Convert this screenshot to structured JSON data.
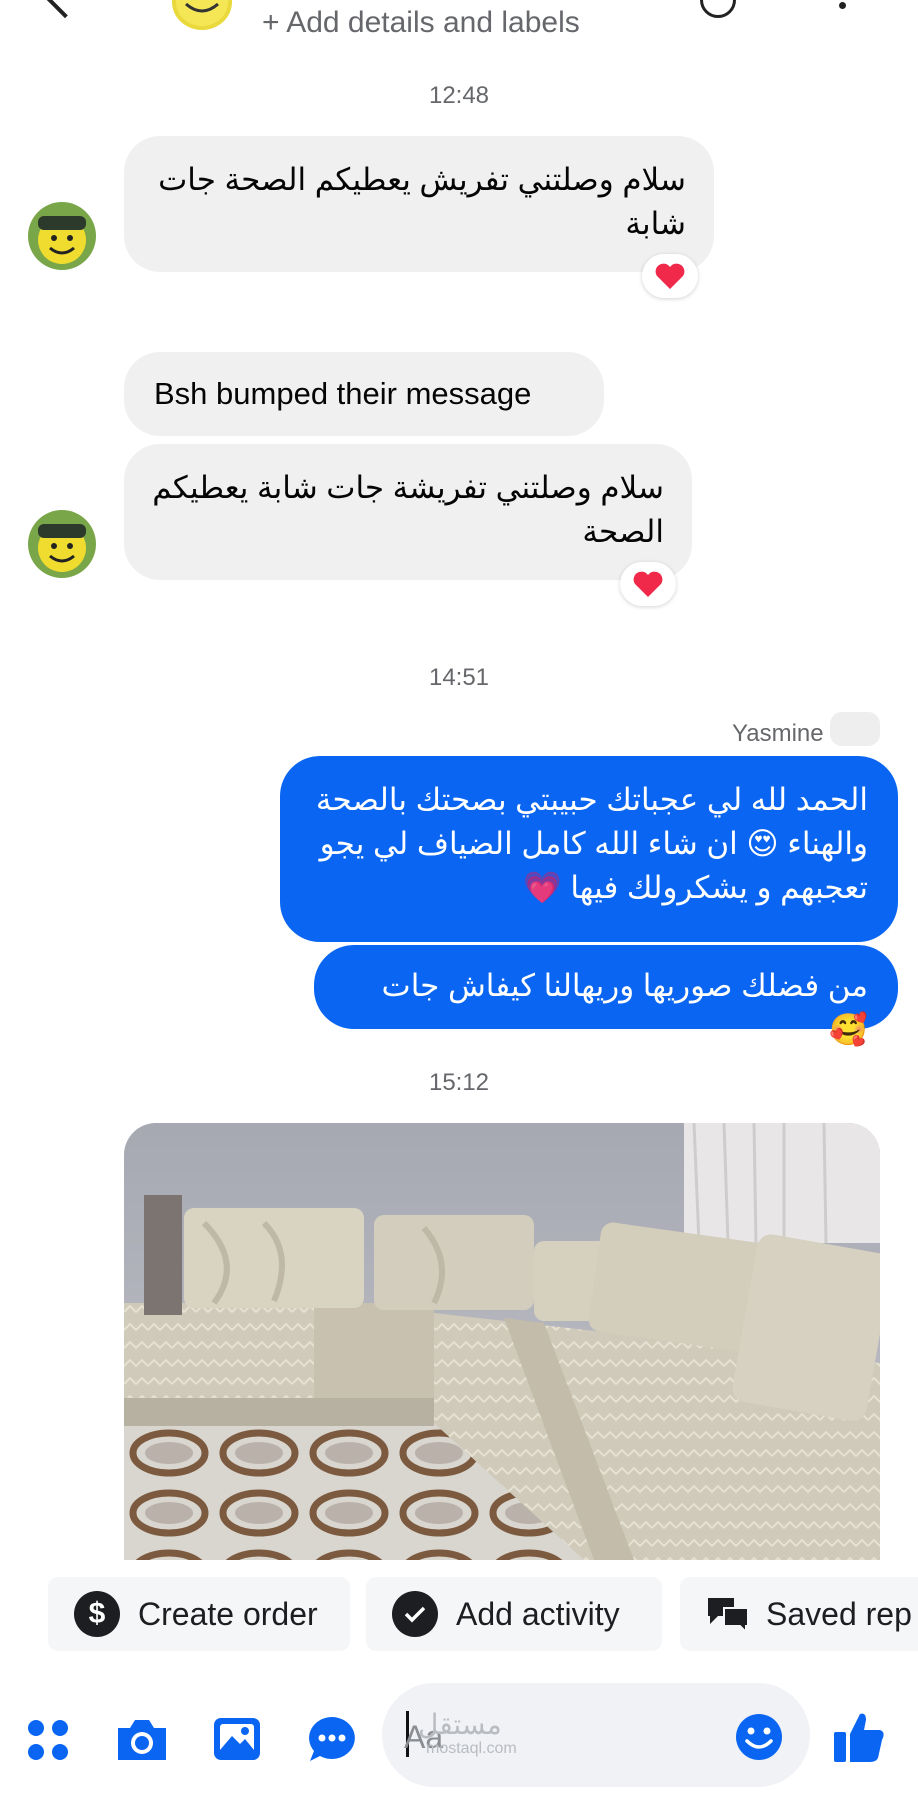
{
  "header": {
    "add_details_label": "+ Add details and labels",
    "back_icon": "chevron-left-icon",
    "payment_icon": "dollar-circle-icon",
    "menu_icon": "more-vertical-icon"
  },
  "messages": {
    "time1": "12:48",
    "msg1": "سلام وصلتني تفريش يعطيكم  الصحة جات شابة",
    "bumped": "Bsh bumped their message",
    "msg2": "سلام وصلتني تفريشة  جات شابة يعطيكم الصحة",
    "time2": "14:51",
    "sender": "Yasmine",
    "out1_line1": "الحمد لله لي عجباتك حبيبتي بصحتك بالصحة",
    "out1_line2": "والهناء 😍 ان شاء الله كامل الضياف لي يجو",
    "out1_line3": "تعجبهم و يشكرولك فيها 💗",
    "out2": "من فضلك صوريها وريهالنا كيفاش جات 🥰",
    "time3": "15:12",
    "reaction": "❤️"
  },
  "chips": {
    "create_order": "Create order",
    "add_activity": "Add activity",
    "saved_replies": "Saved rep"
  },
  "composer": {
    "placeholder": "Aa",
    "watermark": "مستقل",
    "watermark_sub": "mostaql.com"
  },
  "colors": {
    "outgoing_bubble": "#0a66f2",
    "incoming_bubble": "#f0f0f0",
    "accent": "#0a66f2"
  }
}
